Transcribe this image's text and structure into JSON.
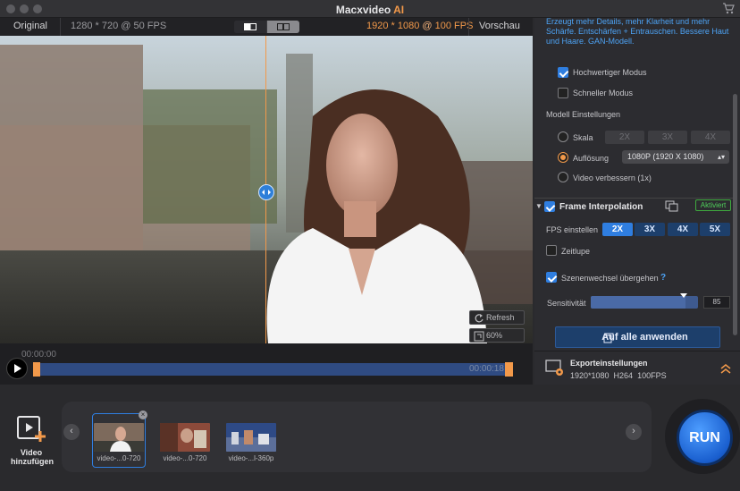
{
  "window": {
    "title": "Macxvideo",
    "title_accent": "AI"
  },
  "topbar": {
    "original_label": "Original",
    "source_info": "1280 * 720 @ 50 FPS",
    "output_res": "1920 * 1080",
    "output_at": "@",
    "output_fps": "100 FPS",
    "preview_label": "Vorschau"
  },
  "video": {
    "refresh_label": "Refresh",
    "zoom_label": "60%"
  },
  "timeline": {
    "current_time": "00:00:00",
    "end_time": "00:00:18"
  },
  "panel": {
    "description": "Erzeugt mehr Details, mehr Klarheit und mehr Schärfe. Entschärfen + Entrauschen. Bessere Haut und Haare. GAN-Modell.",
    "high_quality_label": "Hochwertiger Modus",
    "high_quality_checked": true,
    "fast_label": "Schneller Modus",
    "fast_checked": false,
    "model_settings_label": "Modell Einstellungen",
    "scale_label": "Skala",
    "scale_options": [
      "2X",
      "3X",
      "4X"
    ],
    "resolution_label": "Auflösung",
    "resolution_value": "1080P (1920 X 1080)",
    "enhance_label": "Video verbessern (1x)",
    "selected_mode": "Auflösung",
    "frame_interp_label": "Frame Interpolation",
    "frame_interp_checked": true,
    "activated_label": "Aktiviert",
    "fps_label": "FPS einstellen",
    "fps_options": [
      "2X",
      "3X",
      "4X",
      "5X"
    ],
    "fps_selected": "2X",
    "slowmo_label": "Zeitlupe",
    "slowmo_checked": false,
    "scene_label": "Szenenwechsel übergehen",
    "scene_checked": true,
    "help_icon": "?",
    "sensitivity_label": "Sensitivität",
    "sensitivity_value": "85",
    "apply_all_label": "Auf alle anwenden"
  },
  "export": {
    "title": "Exporteinstellungen",
    "details": "1920*1080  H264  100FPS"
  },
  "bottom": {
    "add_video_label": "Video hinzufügen",
    "thumbnails": [
      {
        "label": "video-...0-720",
        "selected": true
      },
      {
        "label": "video-...0-720",
        "selected": false
      },
      {
        "label": "video-...l-360p",
        "selected": false
      }
    ],
    "run_label": "RUN"
  },
  "colors": {
    "accent_orange": "#f2994a",
    "accent_blue": "#2f7ee0",
    "active_green": "#4fd05a"
  }
}
